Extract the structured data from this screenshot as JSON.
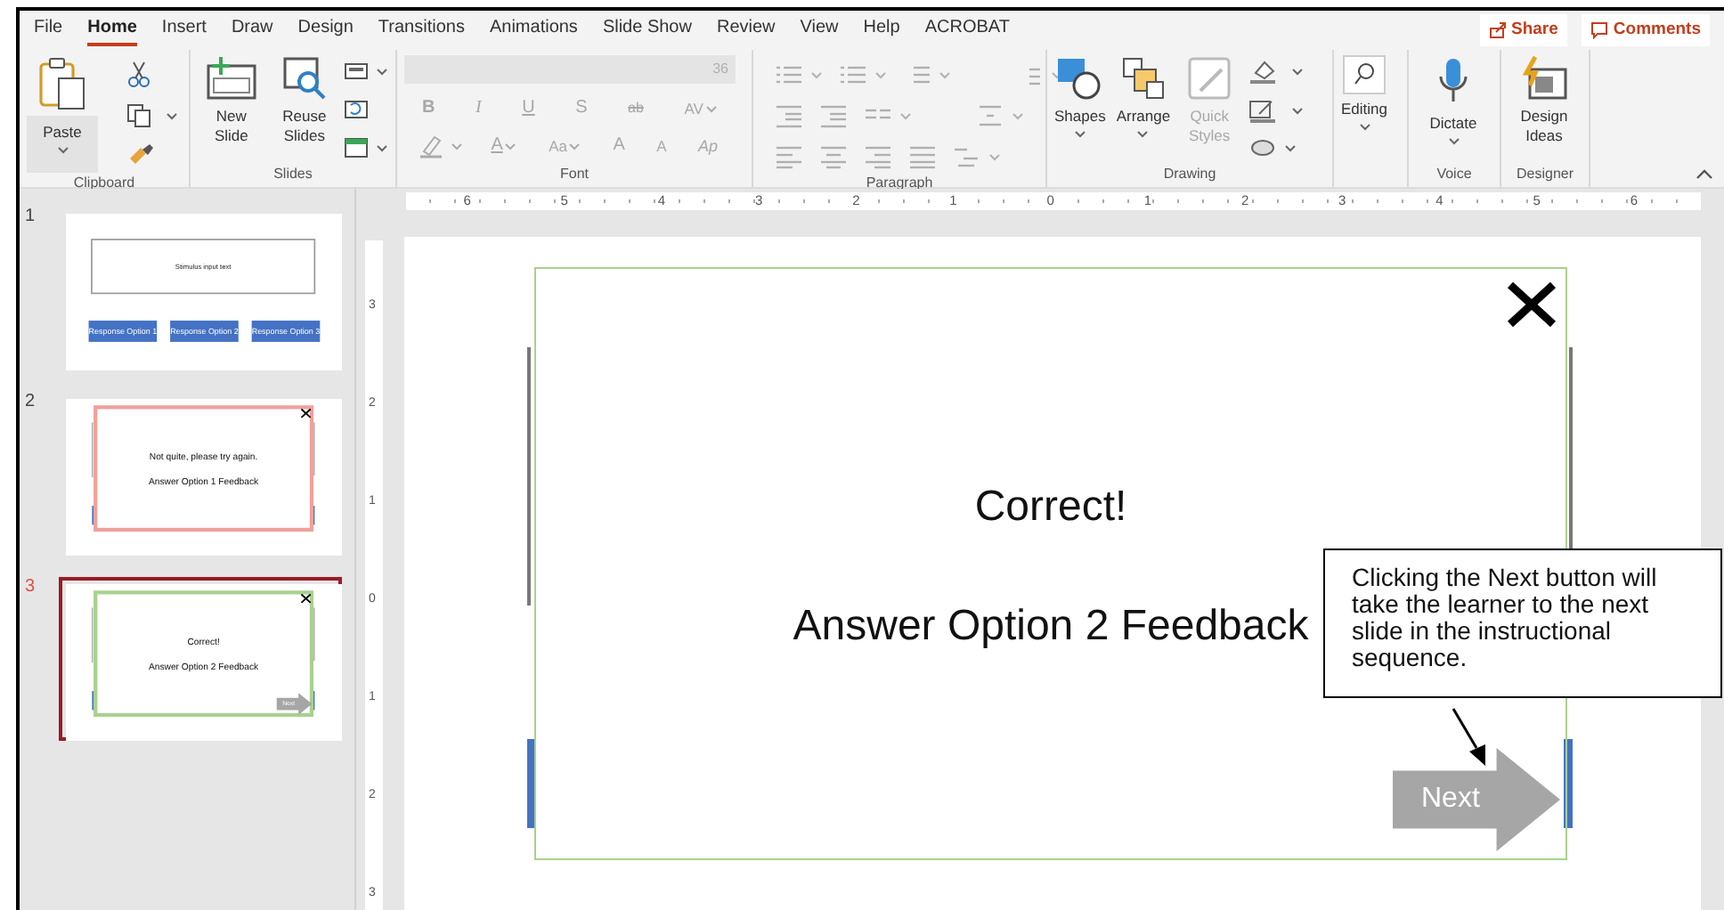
{
  "tabs": [
    {
      "label": "File",
      "selected": false
    },
    {
      "label": "Home",
      "selected": true
    },
    {
      "label": "Insert",
      "selected": false
    },
    {
      "label": "Draw",
      "selected": false
    },
    {
      "label": "Design",
      "selected": false
    },
    {
      "label": "Transitions",
      "selected": false
    },
    {
      "label": "Animations",
      "selected": false
    },
    {
      "label": "Slide Show",
      "selected": false
    },
    {
      "label": "Review",
      "selected": false
    },
    {
      "label": "View",
      "selected": false
    },
    {
      "label": "Help",
      "selected": false
    },
    {
      "label": "ACROBAT",
      "selected": false
    }
  ],
  "header_buttons": [
    {
      "label": "Share",
      "kind": "share"
    },
    {
      "label": "Comments",
      "kind": "comments"
    }
  ],
  "ribbon": {
    "clipboard": {
      "label": "Clipboard",
      "paste": "Paste"
    },
    "slides": {
      "label": "Slides",
      "new_slide": "New Slide",
      "reuse_slides": "Reuse Slides"
    },
    "font": {
      "label": "Font",
      "disabled": true,
      "font_size": "36",
      "row1": [
        "B",
        "I",
        "U",
        "S",
        "ab",
        "AV"
      ],
      "row2": [
        "A",
        "Aa",
        "A",
        "A",
        "Ap"
      ]
    },
    "paragraph": {
      "label": "Paragraph",
      "disabled": true
    },
    "drawing": {
      "label": "Drawing",
      "shapes": "Shapes",
      "arrange": "Arrange",
      "quick_styles": {
        "label": "Quick Styles",
        "disabled": true
      }
    },
    "editing": {
      "button": "Editing"
    },
    "voice": {
      "label": "Voice",
      "button": "Dictate"
    },
    "designer": {
      "label": "Designer",
      "button": "Design Ideas"
    }
  },
  "horizontal_ruler": [
    "6",
    "5",
    "4",
    "3",
    "2",
    "1",
    "0",
    "1",
    "2",
    "3",
    "4",
    "5",
    "6"
  ],
  "vertical_ruler": [
    "3",
    "2",
    "1",
    "0",
    "1",
    "2",
    "3"
  ],
  "slides": [
    {
      "number": "1",
      "selected": false,
      "kind": "stimulus",
      "stimulus": "Stimulus input text",
      "options": [
        "Response Option 1",
        "Response Option 2",
        "Response Option 3"
      ]
    },
    {
      "number": "2",
      "selected": false,
      "kind": "feedback",
      "color": "#f0a09c",
      "heading": "Not quite, please try again.",
      "feedback": "Answer Option 1 Feedback"
    },
    {
      "number": "3",
      "selected": true,
      "kind": "feedback",
      "color": "#a9d18e",
      "heading": "Correct!",
      "feedback": "Answer Option 2 Feedback",
      "next_label": "Next"
    }
  ],
  "main_slide": {
    "kind": "feedback",
    "color": "#a9d18e",
    "heading": "Correct!",
    "feedback": "Answer Option 2 Feedback",
    "next_label": "Next"
  },
  "callout": "Clicking the Next button will take the learner to the next slide in the instructional sequence."
}
